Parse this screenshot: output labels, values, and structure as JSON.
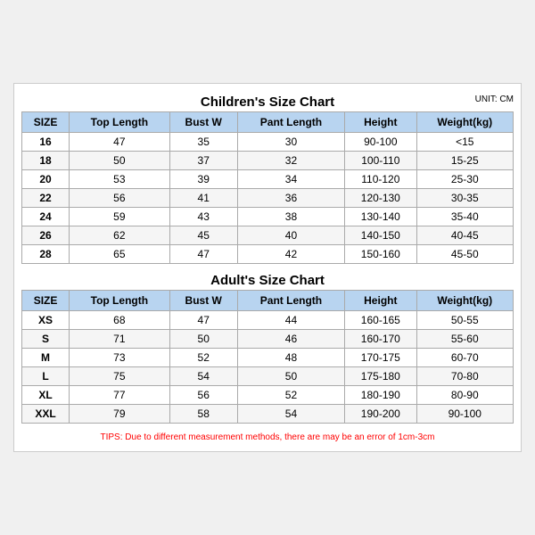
{
  "children_title": "Children's Size Chart",
  "adult_title": "Adult's Size Chart",
  "unit": "UNIT: CM",
  "children_headers": [
    "SIZE",
    "Top Length",
    "Bust W",
    "Pant Length",
    "Height",
    "Weight(kg)"
  ],
  "children_rows": [
    [
      "16",
      "47",
      "35",
      "30",
      "90-100",
      "<15"
    ],
    [
      "18",
      "50",
      "37",
      "32",
      "100-110",
      "15-25"
    ],
    [
      "20",
      "53",
      "39",
      "34",
      "110-120",
      "25-30"
    ],
    [
      "22",
      "56",
      "41",
      "36",
      "120-130",
      "30-35"
    ],
    [
      "24",
      "59",
      "43",
      "38",
      "130-140",
      "35-40"
    ],
    [
      "26",
      "62",
      "45",
      "40",
      "140-150",
      "40-45"
    ],
    [
      "28",
      "65",
      "47",
      "42",
      "150-160",
      "45-50"
    ]
  ],
  "adult_headers": [
    "SIZE",
    "Top Length",
    "Bust W",
    "Pant Length",
    "Height",
    "Weight(kg)"
  ],
  "adult_rows": [
    [
      "XS",
      "68",
      "47",
      "44",
      "160-165",
      "50-55"
    ],
    [
      "S",
      "71",
      "50",
      "46",
      "160-170",
      "55-60"
    ],
    [
      "M",
      "73",
      "52",
      "48",
      "170-175",
      "60-70"
    ],
    [
      "L",
      "75",
      "54",
      "50",
      "175-180",
      "70-80"
    ],
    [
      "XL",
      "77",
      "56",
      "52",
      "180-190",
      "80-90"
    ],
    [
      "XXL",
      "79",
      "58",
      "54",
      "190-200",
      "90-100"
    ]
  ],
  "tips": "TIPS: Due to different measurement methods, there are may be an error of 1cm-3cm"
}
